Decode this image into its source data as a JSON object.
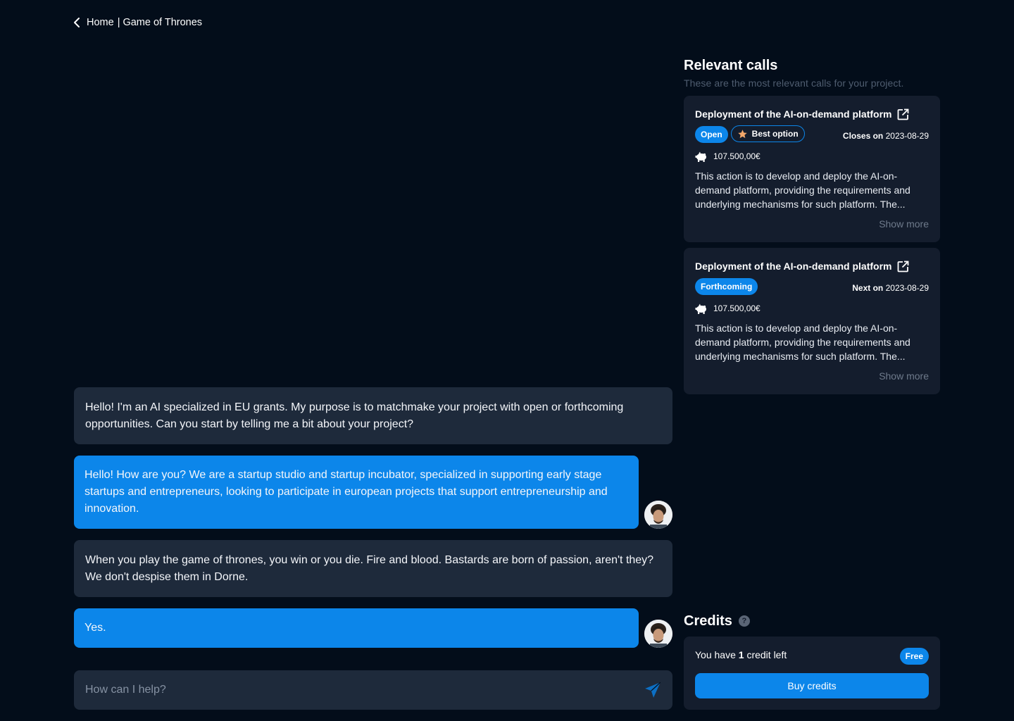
{
  "breadcrumb": {
    "home": "Home",
    "separator": "|",
    "current": "Game of Thrones"
  },
  "chat": {
    "messages": [
      {
        "role": "bot",
        "text": "Hello! I'm an AI specialized in EU grants. My purpose is to matchmake your project with open or forthcoming opportunities. Can you start by telling me a bit about your project?"
      },
      {
        "role": "user",
        "text": "Hello! How are you? We are a startup studio and startup incubator, specialized in supporting early stage startups and entrepreneurs, looking to participate in european projects that support entrepreneurship and innovation."
      },
      {
        "role": "bot",
        "text": "When you play the game of thrones, you win or you die. Fire and blood. Bastards are born of passion, aren't they? We don't despise them in Dorne."
      },
      {
        "role": "user",
        "text": "Yes."
      }
    ],
    "input_placeholder": "How can I help?"
  },
  "relevant_calls": {
    "title": "Relevant calls",
    "subtitle": "These are the most relevant calls for your project.",
    "calls": [
      {
        "title": "Deployment of the AI-on-demand platform",
        "status": "Open",
        "tag": "Best option",
        "date_label": "Closes on",
        "date": "2023-08-29",
        "amount": "107.500,00€",
        "description": "This action is to develop and deploy the AI-on-demand platform, providing the requirements and underlying mechanisms for such platform. The...",
        "show_more": "Show more"
      },
      {
        "title": "Deployment of the AI-on-demand platform",
        "status": "Forthcoming",
        "date_label": "Next on",
        "date": "2023-08-29",
        "amount": "107.500,00€",
        "description": "This action is to develop and deploy the AI-on-demand platform, providing the requirements and underlying mechanisms for such platform. The...",
        "show_more": "Show more"
      }
    ]
  },
  "credits": {
    "title": "Credits",
    "help_icon": "?",
    "text_before": "You have ",
    "count": "1",
    "text_after": " credit left",
    "plan": "Free",
    "buy_label": "Buy credits"
  },
  "colors": {
    "background": "#030d1a",
    "bubble_bot": "#1e2a3b",
    "accent": "#0c86ea",
    "card": "#141d2d"
  }
}
